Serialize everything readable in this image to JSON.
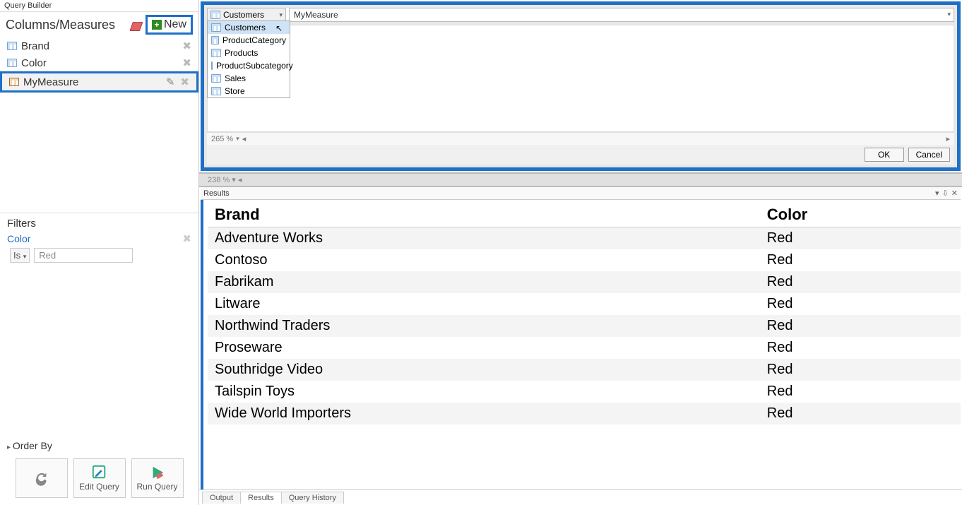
{
  "qb": {
    "title": "Query Builder"
  },
  "cm": {
    "title": "Columns/Measures",
    "new_label": "New"
  },
  "columns": [
    {
      "label": "Brand",
      "type": "col"
    },
    {
      "label": "Color",
      "type": "col"
    },
    {
      "label": "MyMeasure",
      "type": "measure"
    }
  ],
  "filters": {
    "title": "Filters",
    "items": [
      {
        "name": "Color",
        "op": "Is",
        "value": "Red"
      }
    ]
  },
  "orderby": {
    "title": "Order By"
  },
  "buttons": {
    "refresh": "",
    "edit": "Edit Query",
    "run": "Run Query"
  },
  "editor": {
    "table_selected": "Customers",
    "formula": "MyMeasure",
    "dropdown": [
      "Customers",
      "ProductCategory",
      "Products",
      "ProductSubcategory",
      "Sales",
      "Store"
    ],
    "dropdown_selected_index": 0,
    "zoom": "265 %",
    "ok": "OK",
    "cancel": "Cancel"
  },
  "secondary_zoom": "238 %",
  "results": {
    "title": "Results",
    "headers": [
      "Brand",
      "Color"
    ],
    "rows": [
      [
        "Adventure Works",
        "Red"
      ],
      [
        "Contoso",
        "Red"
      ],
      [
        "Fabrikam",
        "Red"
      ],
      [
        "Litware",
        "Red"
      ],
      [
        "Northwind Traders",
        "Red"
      ],
      [
        "Proseware",
        "Red"
      ],
      [
        "Southridge Video",
        "Red"
      ],
      [
        "Tailspin Toys",
        "Red"
      ],
      [
        "Wide World Importers",
        "Red"
      ]
    ]
  },
  "tabs": [
    "Output",
    "Results",
    "Query History"
  ],
  "active_tab": 1
}
